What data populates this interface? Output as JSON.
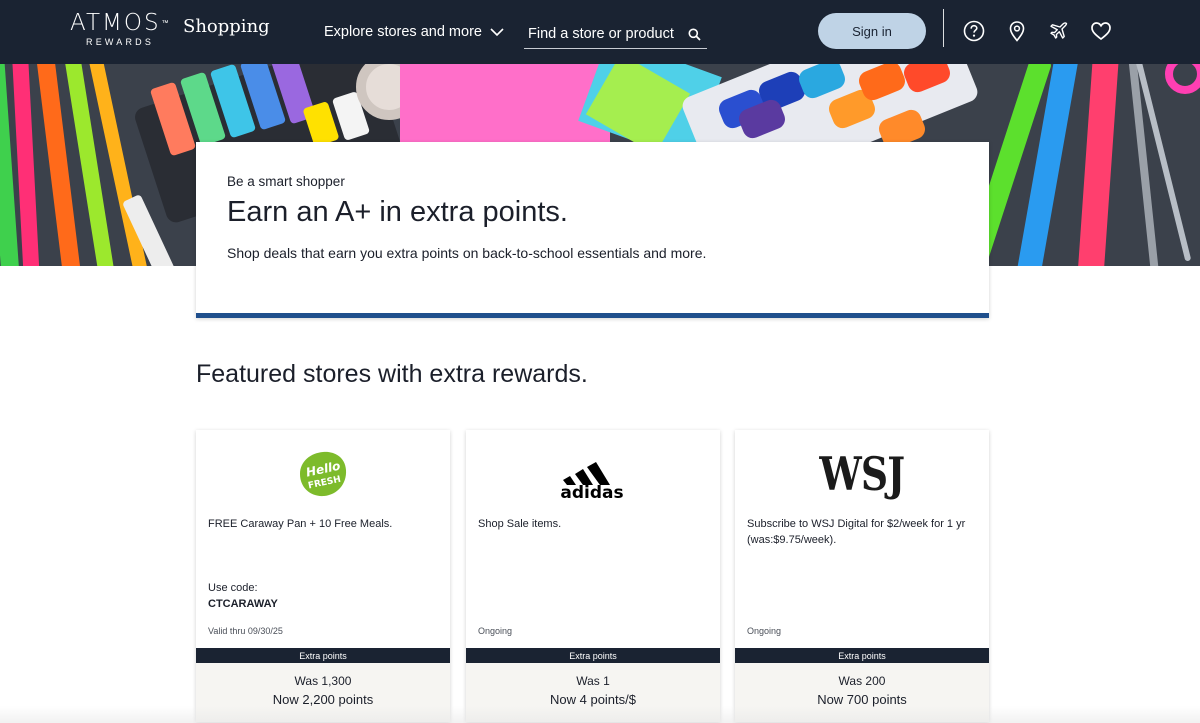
{
  "header": {
    "logo_main": "ATMOS",
    "logo_tm": "™",
    "logo_sub": "REWARDS",
    "logo_shopping": "Shopping",
    "explore_label": "Explore stores and more",
    "search_placeholder": "Find a store or product",
    "signin_label": "Sign in",
    "icons": [
      "help-icon",
      "location-pin-icon",
      "airplane-icon",
      "heart-icon"
    ]
  },
  "hero": {
    "eyebrow": "Be a smart shopper",
    "title": "Earn an A+ in extra points.",
    "description": "Shop deals that earn you extra points on back-to-school essentials and more."
  },
  "featured": {
    "title": "Featured stores with extra rewards.",
    "cards": [
      {
        "logo": "hellofresh-logo",
        "offer": "FREE Caraway Pan + 10 Free Meals.",
        "code_label": "Use code:",
        "code": "CTCARAWAY",
        "validity": "Valid thru 09/30/25",
        "bar_label": "Extra points",
        "was": "Was 1,300",
        "now": "Now 2,200 points"
      },
      {
        "logo": "adidas-logo",
        "offer": "Shop Sale items.",
        "validity": "Ongoing",
        "bar_label": "Extra points",
        "was": "Was 1",
        "now": "Now 4 points/$"
      },
      {
        "logo": "wsj-logo",
        "offer": "Subscribe to WSJ Digital for $2/week for 1 yr (was:$9.75/week).",
        "validity": "Ongoing",
        "bar_label": "Extra points",
        "was": "Was 200",
        "now": "Now 700 points"
      }
    ]
  },
  "logos": {
    "hellofresh_line1": "Hello",
    "hellofresh_line2": "FRESH",
    "adidas": "adidas",
    "wsj": "WSJ"
  },
  "colors": {
    "header_bg": "#1a2332",
    "signin_bg": "#bfd3e6",
    "hero_accent": "#1f4f8c",
    "points_bg": "#f6f5f2",
    "hellofresh_green": "#7dbb2b"
  }
}
